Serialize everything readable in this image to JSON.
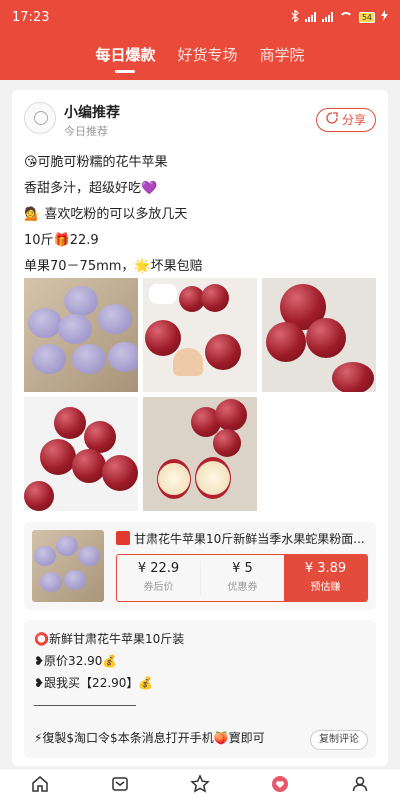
{
  "status": {
    "time": "17:23",
    "battery": "54"
  },
  "tabs": [
    {
      "label": "每日爆款"
    },
    {
      "label": "好货专场"
    },
    {
      "label": "商学院"
    }
  ],
  "post": {
    "author": "小编推荐",
    "subtitle": "今日推荐",
    "share_label": "分享",
    "lines": [
      "😘可脆可粉糯的花牛苹果",
      "香甜多汁，超级好吃💜",
      "💁 喜欢吃粉的可以多放几天",
      "10斤🎁22.9",
      "单果70－75mm，🌟坏果包赔"
    ]
  },
  "product": {
    "title": "甘肃花牛苹果10斤新鲜当季水果蛇果粉面...",
    "price_value": "¥ 22.9",
    "price_label": "券后价",
    "coupon_value": "¥ 5",
    "coupon_label": "优惠券",
    "earn_value": "¥ 3.89",
    "earn_label": "预估赚"
  },
  "copytext": {
    "lines": [
      "⭕新鲜甘肃花牛苹果10斤装",
      "❥原价32.90💰",
      "❥跟我买【22.90】💰"
    ],
    "last_line": "⚡復製$淘口令$本条消息打开手机🍑寳即可",
    "button": "复制评论"
  },
  "bottom_nav": [
    {
      "icon": "home-icon"
    },
    {
      "icon": "inbox-icon"
    },
    {
      "icon": "star-icon"
    },
    {
      "icon": "heart-badge-icon"
    },
    {
      "icon": "user-icon"
    }
  ],
  "colors": {
    "brand": "#ea4a3a",
    "accent": "#e34b3b"
  }
}
